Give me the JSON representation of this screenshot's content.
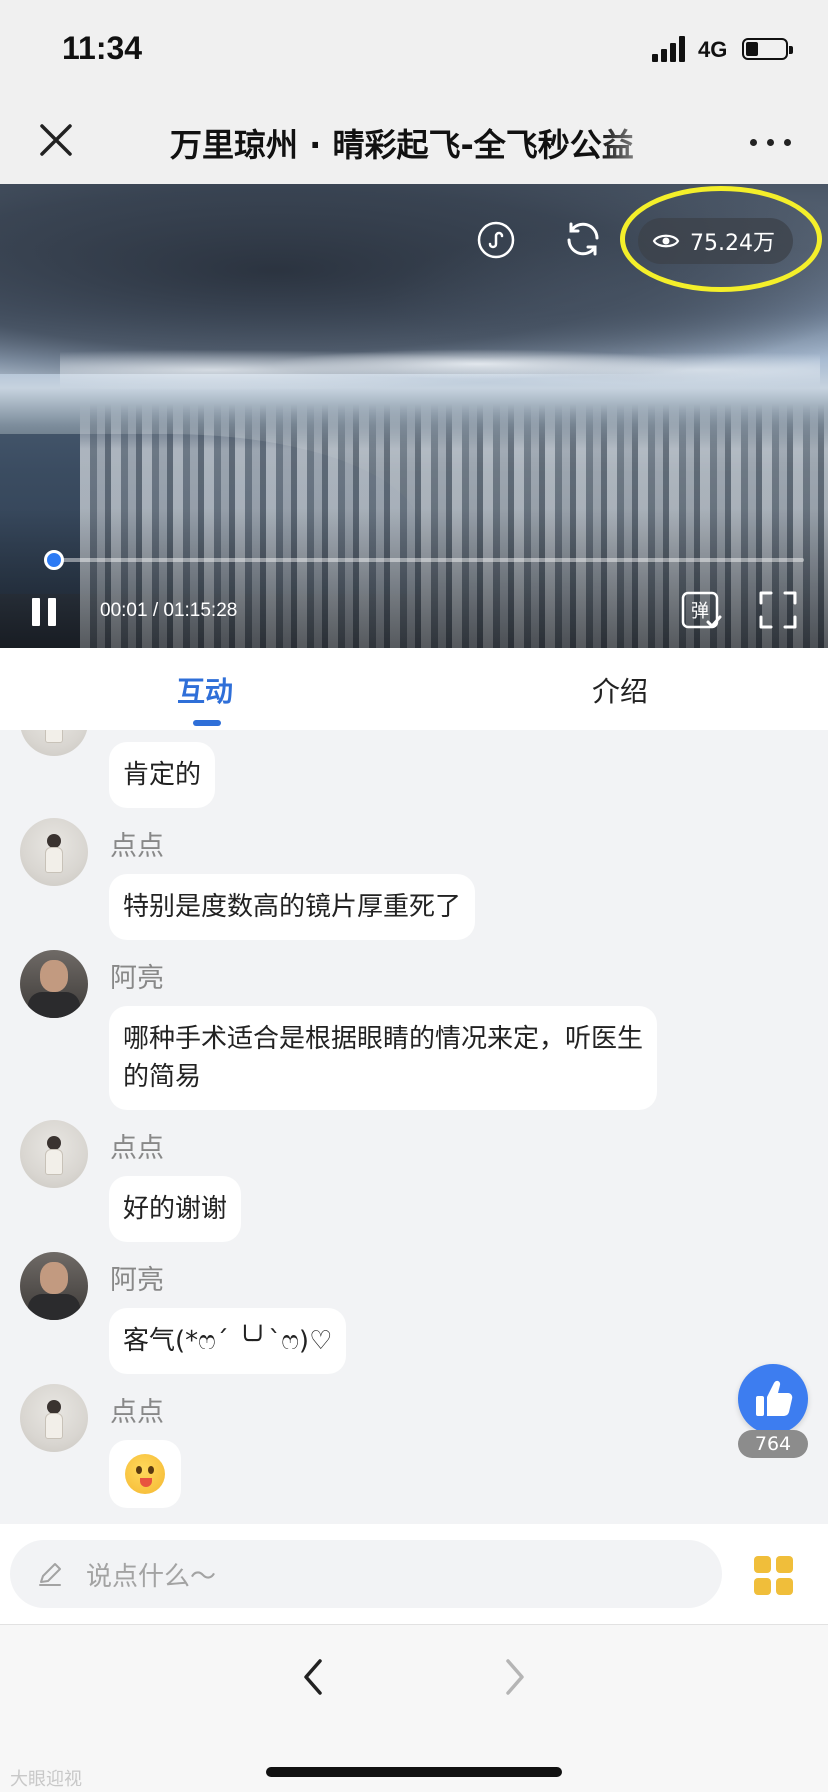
{
  "status": {
    "time": "11:34",
    "network": "4G"
  },
  "nav": {
    "title": "万里琼州 · 晴彩起飞-全飞秒公益"
  },
  "video": {
    "views": "75.24万",
    "time": "00:01 / 01:15:28",
    "progress": 0.0002,
    "danmu_label": "弹"
  },
  "tabs": [
    {
      "label": "互动",
      "active": true
    },
    {
      "label": "介绍",
      "active": false
    }
  ],
  "messages": [
    {
      "avatar": "girl",
      "nick": "",
      "text": "肯定的"
    },
    {
      "avatar": "girl",
      "nick": "点点",
      "text": "特别是度数高的镜片厚重死了"
    },
    {
      "avatar": "man",
      "nick": "阿亮",
      "text_line1": "哪种手术适合是根据眼睛的情况来定，听医生",
      "text_line2": "的简易"
    },
    {
      "avatar": "girl",
      "nick": "点点",
      "text": "好的谢谢"
    },
    {
      "avatar": "man",
      "nick": "阿亮",
      "text": "客气(*ෆ´ ╰╯`ෆ)♡"
    },
    {
      "avatar": "girl",
      "nick": "点点",
      "emoji": "tongue-out-face"
    }
  ],
  "like": {
    "count": "764"
  },
  "input": {
    "placeholder": "说点什么～"
  },
  "watermark": "大眼迎视",
  "colors": {
    "accent": "#2f6fd8",
    "like": "#3d7df0",
    "highlight": "#f4ef2a",
    "grid": "#f0be3a"
  }
}
